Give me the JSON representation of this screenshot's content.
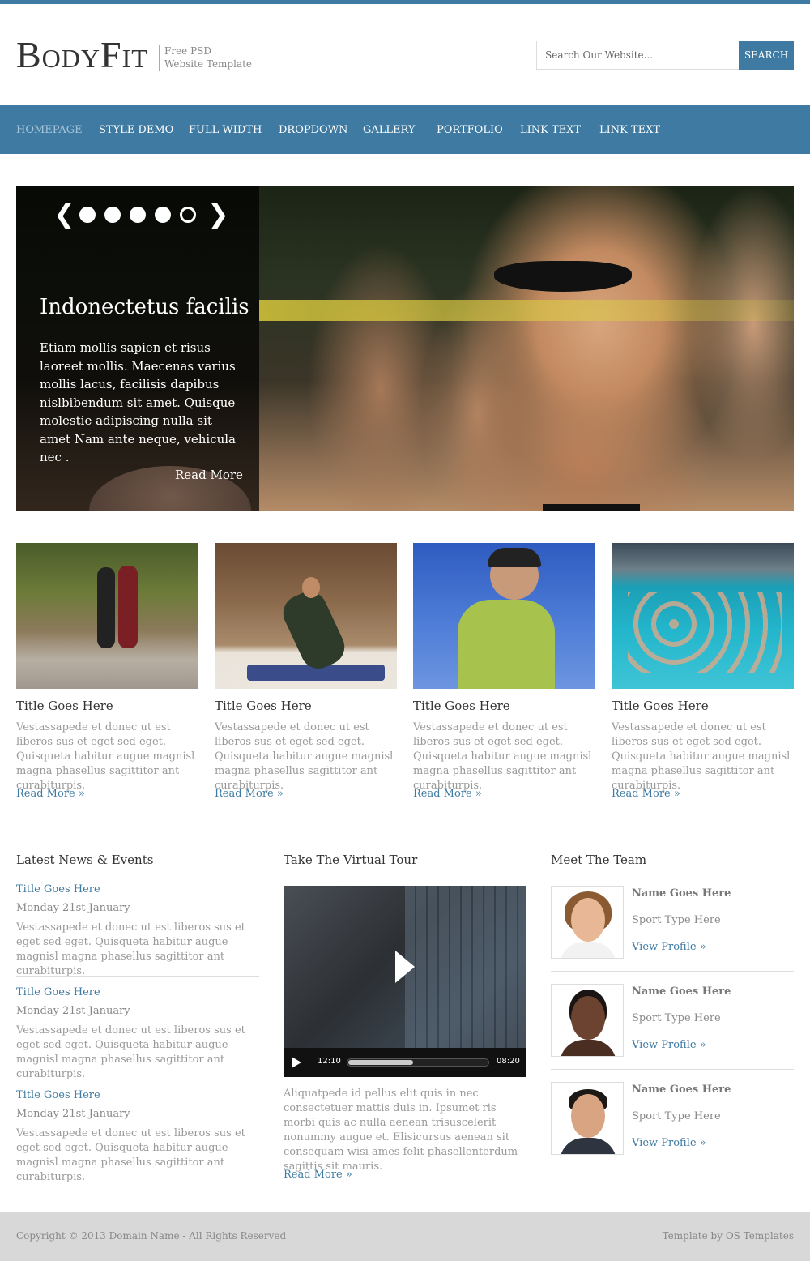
{
  "header": {
    "logo": "BodyFit",
    "tagline_line1": "Free PSD",
    "tagline_line2": "Website Template",
    "search_placeholder": "Search Our Website...",
    "search_button": "SEARCH"
  },
  "nav": {
    "items": [
      "HOMEPAGE",
      "STYLE DEMO",
      "FULL WIDTH",
      "DROPDOWN",
      "GALLERY",
      "PORTFOLIO",
      "LINK TEXT",
      "LINK TEXT"
    ],
    "active_index": 0
  },
  "slider": {
    "prev_icon": "chevron-left-icon",
    "next_icon": "chevron-right-icon",
    "slide_count": 5,
    "active_slide": 5,
    "title": "Indonectetus facilis",
    "text": "Etiam mollis sapien et risus laoreet mollis. Maecenas varius mollis lacus, facilisis dapibus nislbibendum sit amet. Quisque molestie adipiscing nulla sit amet Nam ante neque, vehicula nec .",
    "read_more": "Read More"
  },
  "features": [
    {
      "title": "Title Goes Here",
      "text": "Vestassapede et donec ut est liberos sus et eget sed eget. Quisqueta habitur augue magnisl magna phasellus sagittitor ant curabiturpis.",
      "more": "Read More »"
    },
    {
      "title": "Title Goes Here",
      "text": "Vestassapede et donec ut est liberos sus et eget sed eget. Quisqueta habitur augue magnisl magna phasellus sagittitor ant curabiturpis.",
      "more": "Read More »"
    },
    {
      "title": "Title Goes Here",
      "text": "Vestassapede et donec ut est liberos sus et eget sed eget. Quisqueta habitur augue magnisl magna phasellus sagittitor ant curabiturpis.",
      "more": "Read More »"
    },
    {
      "title": "Title Goes Here",
      "text": "Vestassapede et donec ut est liberos sus et eget sed eget. Quisqueta habitur augue magnisl magna phasellus sagittitor ant curabiturpis.",
      "more": "Read More »"
    }
  ],
  "news": {
    "title": "Latest News & Events",
    "items": [
      {
        "title": "Title Goes Here",
        "date": "Monday 21st January",
        "text": "Vestassapede et donec ut est liberos sus et eget sed eget. Quisqueta habitur augue magnisl magna phasellus sagittitor ant curabiturpis."
      },
      {
        "title": "Title Goes Here",
        "date": "Monday 21st January",
        "text": "Vestassapede et donec ut est liberos sus et eget sed eget. Quisqueta habitur augue magnisl magna phasellus sagittitor ant curabiturpis."
      },
      {
        "title": "Title Goes Here",
        "date": "Monday 21st January",
        "text": "Vestassapede et donec ut est liberos sus et eget sed eget. Quisqueta habitur augue magnisl magna phasellus sagittitor ant curabiturpis."
      }
    ]
  },
  "tour": {
    "title": "Take The Virtual Tour",
    "current_time": "12:10",
    "duration": "08:20",
    "progress": 0.46,
    "description": "Aliquatpede id pellus elit quis in nec consectetuer mattis duis in. Ipsumet ris morbi quis ac nulla aenean trisuscelerit nonummy augue et. Elisicursus aenean sit consequam wisi ames felit phasellenterdum sagittis sit mauris.",
    "more": "Read More »"
  },
  "team": {
    "title": "Meet The Team",
    "members": [
      {
        "name": "Name Goes Here",
        "sport": "Sport Type Here",
        "link": "View Profile »"
      },
      {
        "name": "Name Goes Here",
        "sport": "Sport Type Here",
        "link": "View Profile »"
      },
      {
        "name": "Name Goes Here",
        "sport": "Sport Type Here",
        "link": "View Profile »"
      }
    ]
  },
  "footer": {
    "copyright": "Copyright © 2013 Domain Name - All Rights Reserved",
    "credit": "Template by OS Templates"
  },
  "colors": {
    "accent": "#3e7aa1",
    "footer_bg": "#d8d8d8"
  }
}
